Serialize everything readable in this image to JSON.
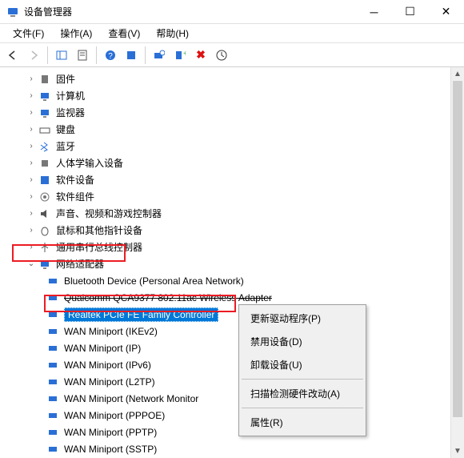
{
  "window": {
    "title": "设备管理器"
  },
  "menu": {
    "file": "文件(F)",
    "action": "操作(A)",
    "view": "查看(V)",
    "help": "帮助(H)"
  },
  "tree": {
    "firmware": "固件",
    "computer": "计算机",
    "monitor": "监视器",
    "keyboard": "键盘",
    "bluetooth": "蓝牙",
    "hid": "人体学输入设备",
    "software_devices": "软件设备",
    "software_components": "软件组件",
    "sound": "声音、视频和游戏控制器",
    "mouse": "鼠标和其他指针设备",
    "usb": "通用串行总线控制器",
    "network_adapters": "网络适配器",
    "children": {
      "bt_pan": "Bluetooth Device (Personal Area Network)",
      "qca": "Qualcomm QCA9377 802.11ac Wireless Adapter",
      "realtek": "Realtek PCIe FE Family Controller",
      "wan_ikev2": "WAN Miniport (IKEv2)",
      "wan_ip": "WAN Miniport (IP)",
      "wan_ipv6": "WAN Miniport (IPv6)",
      "wan_l2tp": "WAN Miniport (L2TP)",
      "wan_netmon": "WAN Miniport (Network Monitor",
      "wan_pppoe": "WAN Miniport (PPPOE)",
      "wan_pptp": "WAN Miniport (PPTP)",
      "wan_sstp": "WAN Miniport (SSTP)"
    }
  },
  "context_menu": {
    "update_driver": "更新驱动程序(P)",
    "disable": "禁用设备(D)",
    "uninstall": "卸载设备(U)",
    "scan_hw": "扫描检测硬件改动(A)",
    "properties": "属性(R)"
  }
}
